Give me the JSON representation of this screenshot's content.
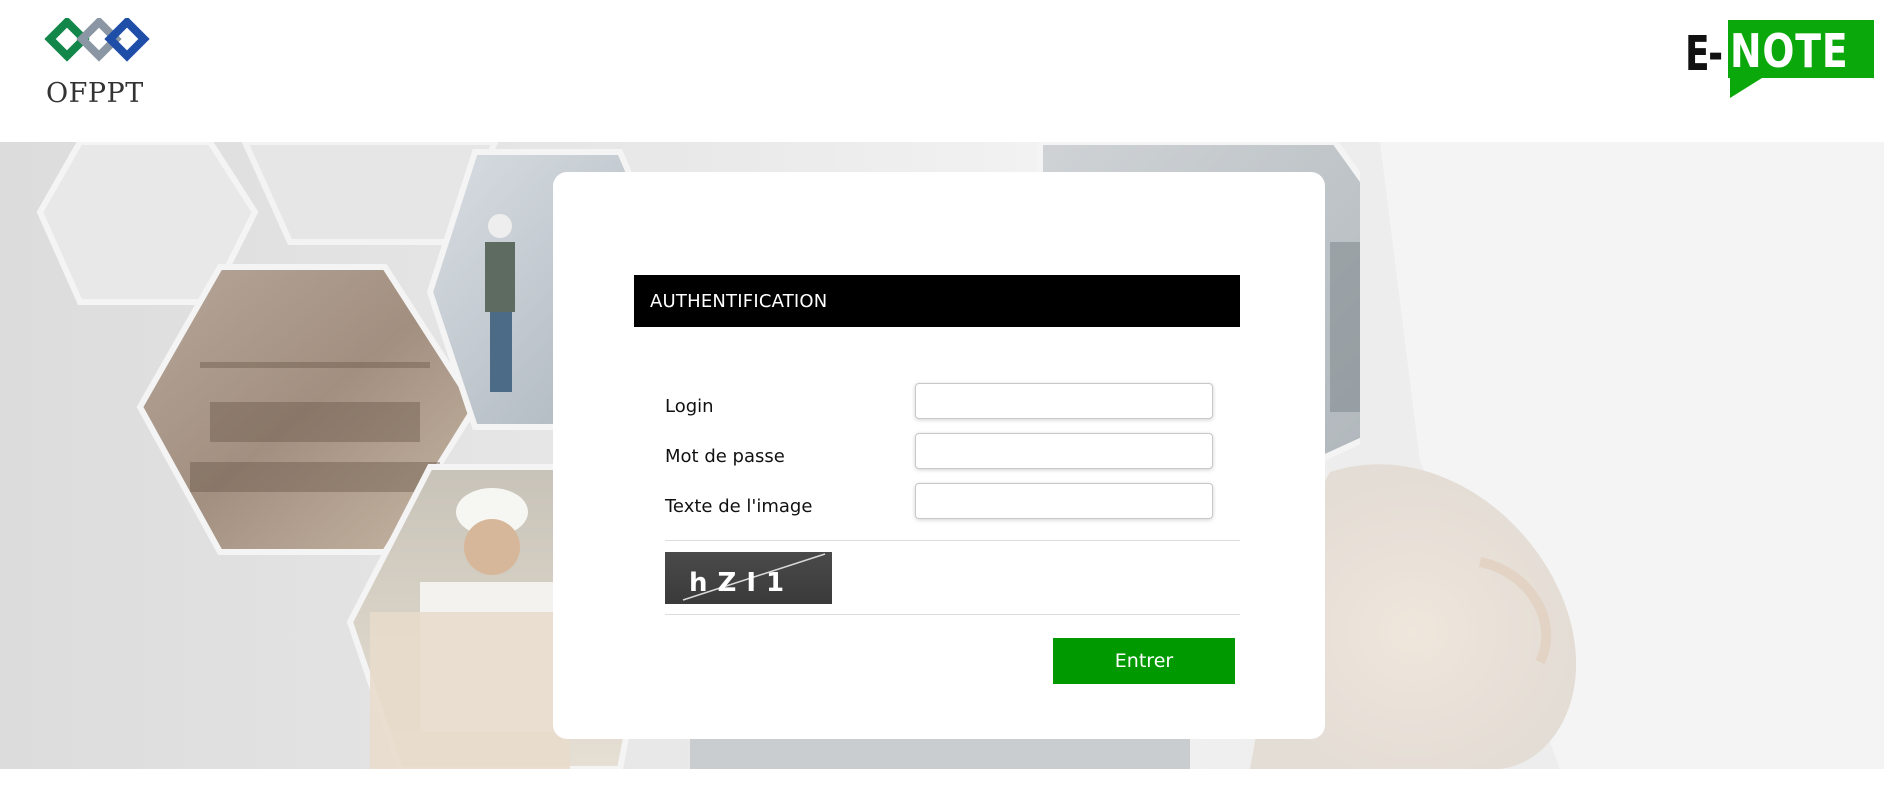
{
  "header": {
    "ofppt_logo_text": "OFPPT",
    "enote_logo_prefix": "E-",
    "enote_logo_word": "NOTE"
  },
  "login": {
    "title": "AUTHENTIFICATION",
    "fields": [
      {
        "label": "Login",
        "value": "",
        "placeholder": ""
      },
      {
        "label": "Mot de passe",
        "value": "",
        "placeholder": ""
      },
      {
        "label": "Texte de l'image",
        "value": "",
        "placeholder": ""
      }
    ],
    "captcha_text": "hZI1",
    "submit_label": "Entrer"
  },
  "colors": {
    "header_bar": "#000000",
    "submit_button": "#009a00",
    "enote_green": "#0aa80a",
    "ofppt_green": "#13874a",
    "ofppt_blue": "#1f4ea8",
    "ofppt_grey": "#8a96a3"
  }
}
